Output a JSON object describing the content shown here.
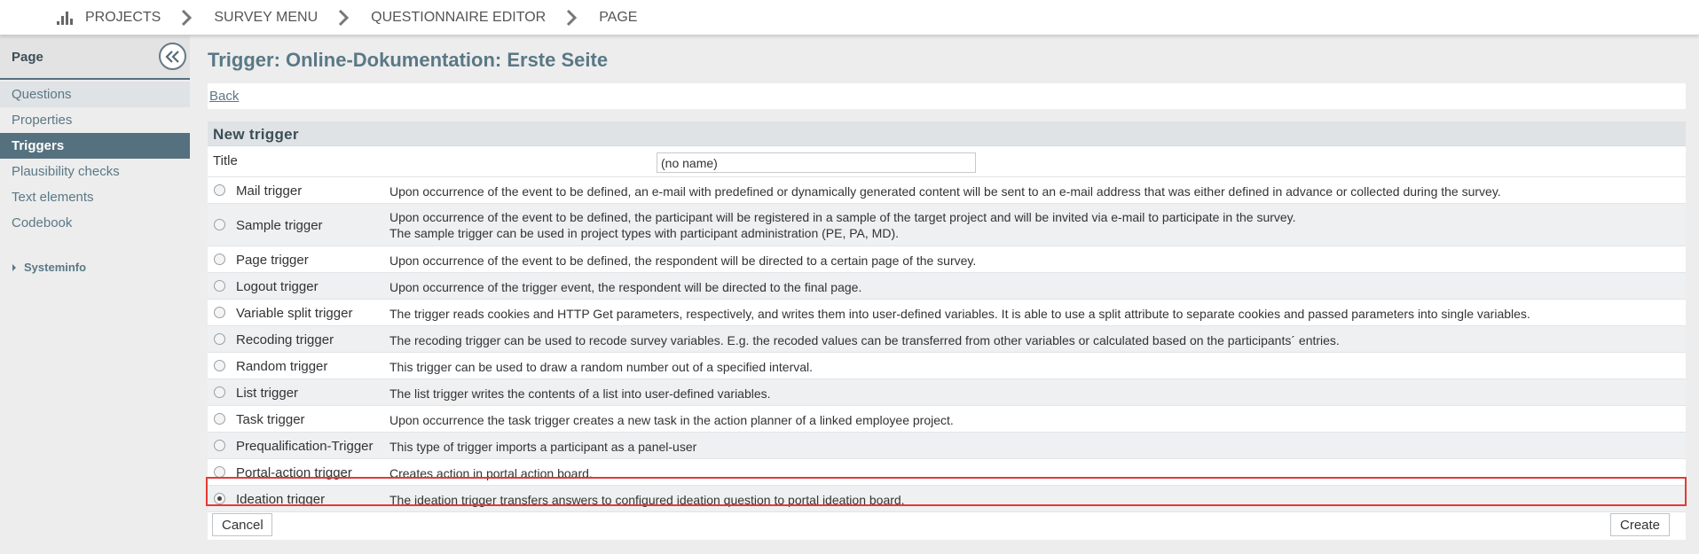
{
  "breadcrumb": [
    {
      "label": "PROJECTS",
      "icon": "bar-chart-icon"
    },
    {
      "label": "SURVEY MENU"
    },
    {
      "label": "QUESTIONNAIRE EDITOR"
    },
    {
      "label": "PAGE"
    }
  ],
  "sidebar": {
    "title": "Page",
    "collapse_icon": "double-chevron-left-icon",
    "items": [
      {
        "label": "Questions"
      },
      {
        "label": "Properties"
      },
      {
        "label": "Triggers",
        "active": true
      },
      {
        "label": "Plausibility checks"
      },
      {
        "label": "Text elements"
      },
      {
        "label": "Codebook"
      }
    ],
    "systeminfo": "Systeminfo"
  },
  "main": {
    "page_title": "Trigger: Online-Dokumentation: Erste Seite",
    "back_label": "Back",
    "panel_title": "New trigger",
    "title_label": "Title",
    "title_value": "(no name)",
    "triggers": [
      {
        "name": "Mail trigger",
        "desc": "Upon occurrence of the event to be defined, an e-mail with predefined or dynamically generated content will be sent to an e-mail address that was either defined in advance or collected during the survey."
      },
      {
        "name": "Sample trigger",
        "desc": "Upon occurrence of the event to be defined, the participant will be registered in a sample of the target project and will be invited via e-mail to participate in the survey.",
        "desc2": "The sample trigger can be used in project types with participant administration (PE, PA, MD)."
      },
      {
        "name": "Page trigger",
        "desc": "Upon occurrence of the event to be defined, the respondent will be directed to a certain page of the survey."
      },
      {
        "name": "Logout trigger",
        "desc": "Upon occurrence of the trigger event, the respondent will be directed to the final page."
      },
      {
        "name": "Variable split trigger",
        "desc": "The trigger reads cookies and HTTP Get parameters, respectively, and writes them into user-defined variables. It is able to use a split attribute to separate cookies and passed parameters into single variables."
      },
      {
        "name": "Recoding trigger",
        "desc": "The recoding trigger can be used to recode survey variables. E.g. the recoded values can be transferred from other variables or calculated based on the participants´ entries."
      },
      {
        "name": "Random trigger",
        "desc": "This trigger can be used to draw a random number out of a specified interval."
      },
      {
        "name": "List trigger",
        "desc": "The list trigger writes the contents of a list into user-defined variables."
      },
      {
        "name": "Task trigger",
        "desc": "Upon occurrence the task trigger creates a new task in the action planner of a linked employee project."
      },
      {
        "name": "Prequalification-Trigger",
        "desc": "This type of trigger imports a participant as a panel-user"
      },
      {
        "name": "Portal-action trigger",
        "desc": "Creates action in portal action board."
      },
      {
        "name": "Ideation trigger",
        "desc": "The ideation trigger transfers answers to configured ideation question to portal ideation board.",
        "selected": true
      }
    ],
    "cancel_label": "Cancel",
    "create_label": "Create"
  },
  "colors": {
    "accent": "#55717f",
    "title_text": "#5a7886",
    "highlight": "#e53935"
  }
}
